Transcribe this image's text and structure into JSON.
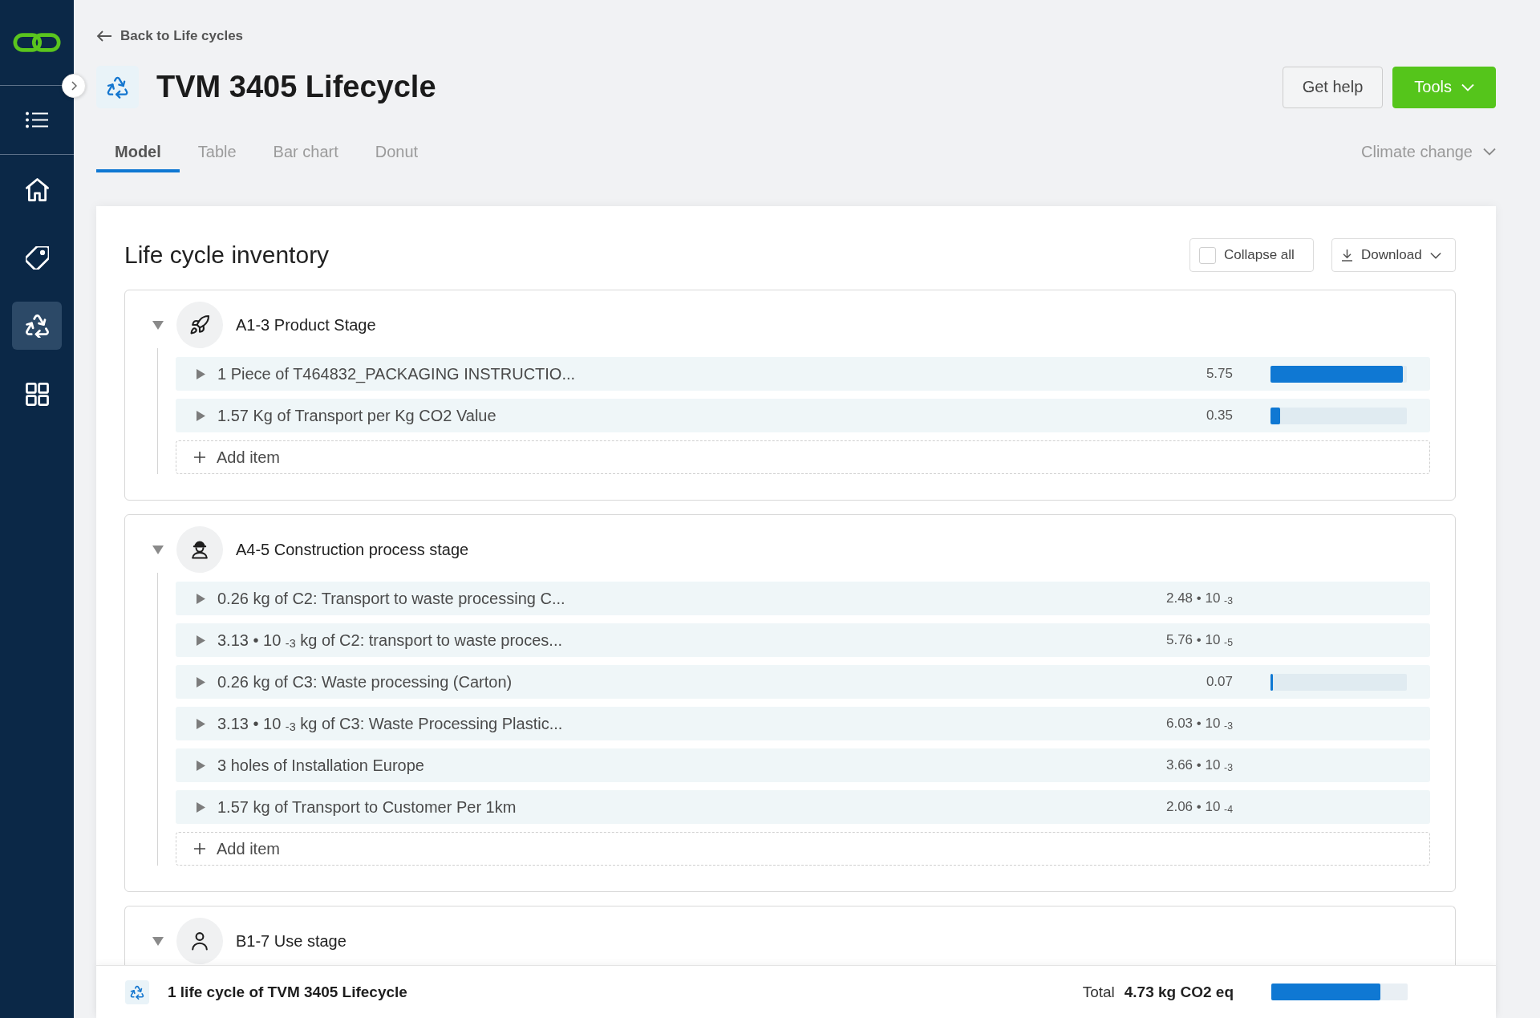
{
  "sidebar": {
    "nav_items": [
      {
        "selected": false
      },
      {
        "selected": false
      },
      {
        "selected": true
      },
      {
        "selected": false
      }
    ]
  },
  "header": {
    "back_link": "Back to Life cycles",
    "title": "TVM 3405 Lifecycle",
    "buttons": [
      {
        "label": "Get help",
        "kind": "secondary"
      },
      {
        "label": "Tools",
        "kind": "primary"
      }
    ]
  },
  "tabs": [
    {
      "label": "Model",
      "selected": true
    },
    {
      "label": "Table",
      "selected": false
    },
    {
      "label": "Bar chart",
      "selected": false
    },
    {
      "label": "Donut",
      "selected": false
    }
  ],
  "impact_dropdown": {
    "value": "Climate change"
  },
  "inventory": {
    "title": "Life cycle inventory",
    "collapse_all": {
      "label": "Collapse all",
      "checked": false
    },
    "download": {
      "label": "Download"
    },
    "groups": [
      {
        "name": "A1-3 Product Stage",
        "expanded": true,
        "rows": [
          {
            "label": "1 Piece of T464832_PACKAGING INSTRUCTIO...",
            "expanded": false,
            "value": "5.75",
            "level": 0.97
          },
          {
            "label": "1.57 Kg of Transport per Kg CO2 Value",
            "expanded": false,
            "value": "0.35",
            "level": 0.07
          }
        ],
        "add_label": "Add item"
      },
      {
        "name": "A4-5 Construction process stage",
        "expanded": true,
        "rows": [
          {
            "label": "0.26 kg of C2: Transport to waste processing C...",
            "expanded": false,
            "value": "2.48 • 10 $_{-3}$"
          },
          {
            "label": "3.13 • 10 $_{-3}$ kg of C2: transport to waste proces...",
            "expanded": false,
            "value": "5.76 • 10 $_{-5}$"
          },
          {
            "label": "0.26 kg of C3: Waste processing (Carton)",
            "expanded": false,
            "value": "0.07",
            "level": 0.015
          },
          {
            "label": "3.13 • 10 $_{-3}$ kg of C3: Waste Processing Plastic...",
            "expanded": false,
            "value": "6.03 • 10 $_{-3}$"
          },
          {
            "label": "3 holes of Installation Europe",
            "expanded": false,
            "value": "3.66 • 10 $_{-3}$"
          },
          {
            "label": "1.57 kg of Transport to Customer Per 1km",
            "expanded": false,
            "value": "2.06 • 10 $_{-4}$"
          }
        ],
        "add_label": "Add item"
      },
      {
        "name": "B1-7 Use stage",
        "expanded": true
      }
    ]
  },
  "footer": {
    "label": "1 life cycle of TVM 3405 Lifecycle",
    "total_label": "Total",
    "total_value": "4.73 kg CO2 eq",
    "level": 0.8
  }
}
